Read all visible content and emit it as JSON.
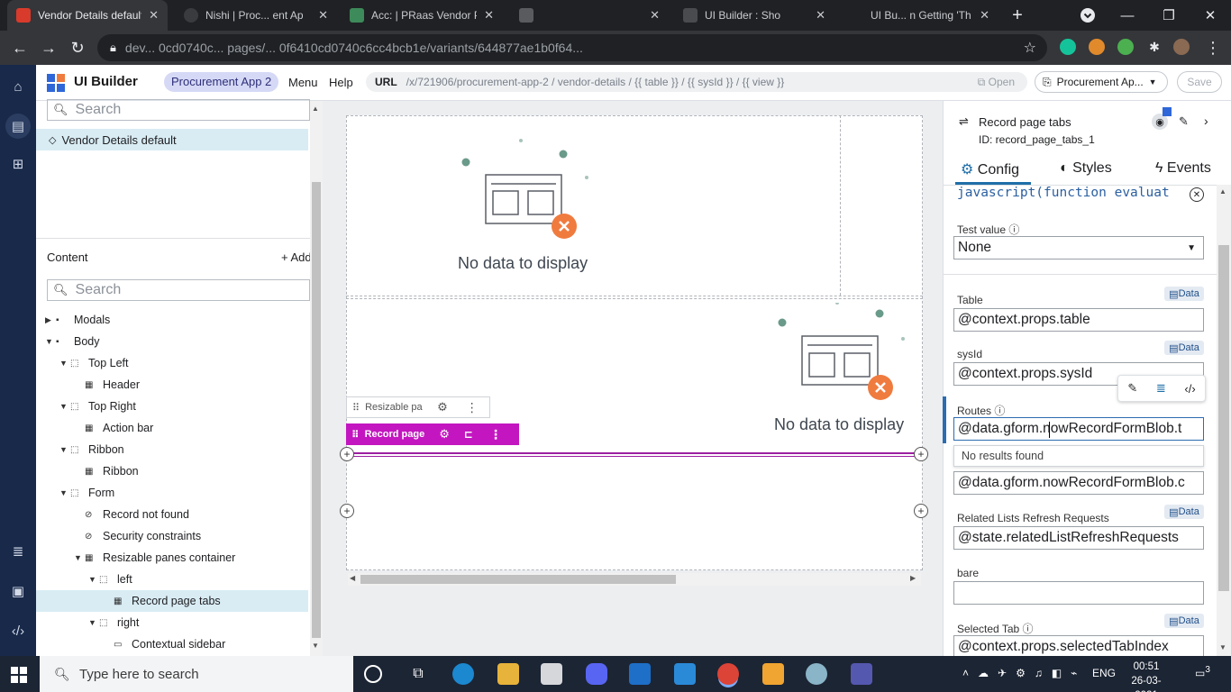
{
  "browser": {
    "tabs": [
      {
        "title": "Vendor Details default",
        "active": true
      },
      {
        "title": "Nishi | Proc... ent Ap",
        "active": false
      },
      {
        "title": "Acc: | PRaas Vendor P",
        "active": false
      },
      {
        "title": "",
        "active": false
      },
      {
        "title": "UI Builder : Sho",
        "active": false
      },
      {
        "title": "UI Bu... n Getting 'Th",
        "active": false
      }
    ],
    "url": "dev... 0cd0740c... pages/... 0f6410cd0740c6cc4bcb1e/variants/644877ae1b0f64...",
    "new_tab": "+",
    "minimize": "—",
    "restore": "❐",
    "close": "✕"
  },
  "app": {
    "brand": "UI Builder",
    "app_name": "Procurement App 2",
    "menu": "Menu",
    "help": "Help",
    "url_label": "URL",
    "url_path": "/x/721906/procurement-app-2 / vendor-details / {{ table }} / {{ sysId }} / {{ view }}",
    "open_label": "Open",
    "variant_select": "Procurement Ap...",
    "save_label": "Save"
  },
  "left": {
    "search_placeholder": "Search",
    "variant": "Vendor Details default",
    "content_header": "Content",
    "add_label": "+ Add",
    "content_search_placeholder": "Search",
    "tree": [
      {
        "label": "Modals",
        "depth": 0,
        "caret": "▶",
        "icon": "▪",
        "selected": false
      },
      {
        "label": "Body",
        "depth": 0,
        "caret": "▼",
        "icon": "▪",
        "selected": false
      },
      {
        "label": "Top Left",
        "depth": 1,
        "caret": "▼",
        "icon": "⬚",
        "selected": false
      },
      {
        "label": "Header",
        "depth": 2,
        "caret": "",
        "icon": "▦",
        "selected": false
      },
      {
        "label": "Top Right",
        "depth": 1,
        "caret": "▼",
        "icon": "⬚",
        "selected": false
      },
      {
        "label": "Action bar",
        "depth": 2,
        "caret": "",
        "icon": "▦",
        "selected": false
      },
      {
        "label": "Ribbon",
        "depth": 1,
        "caret": "▼",
        "icon": "⬚",
        "selected": false
      },
      {
        "label": "Ribbon",
        "depth": 2,
        "caret": "",
        "icon": "▦",
        "selected": false
      },
      {
        "label": "Form",
        "depth": 1,
        "caret": "▼",
        "icon": "⬚",
        "selected": false
      },
      {
        "label": "Record not found",
        "depth": 2,
        "caret": "",
        "icon": "⊘",
        "selected": false
      },
      {
        "label": "Security constraints",
        "depth": 2,
        "caret": "",
        "icon": "⊘",
        "selected": false
      },
      {
        "label": "Resizable panes container",
        "depth": 2,
        "caret": "▼",
        "icon": "▦",
        "selected": false
      },
      {
        "label": "left",
        "depth": 3,
        "caret": "▼",
        "icon": "⬚",
        "selected": false
      },
      {
        "label": "Record page tabs",
        "depth": 4,
        "caret": "",
        "icon": "▦",
        "selected": true
      },
      {
        "label": "right",
        "depth": 3,
        "caret": "▼",
        "icon": "⬚",
        "selected": false
      },
      {
        "label": "Contextual sidebar",
        "depth": 4,
        "caret": "",
        "icon": "▭",
        "selected": false
      }
    ]
  },
  "canvas": {
    "no_data_1": "No data to display",
    "no_data_2": "No data to display",
    "resizable_label": "Resizable pai",
    "record_label": "Record page"
  },
  "right": {
    "component_title": "Record page tabs",
    "component_id": "ID: record_page_tabs_1",
    "tabs": {
      "config": "Config",
      "styles": "Styles",
      "events": "Events"
    },
    "script_line": "javascript(function evaluat",
    "test_value_label": "Test value",
    "test_value": "None",
    "data_badge": "Data",
    "fields": [
      {
        "label": "Table",
        "value": "@context.props.table",
        "badge": true
      },
      {
        "label": "sysId",
        "value": "@context.props.sysId",
        "badge": true
      },
      {
        "label": "Routes",
        "value": "@data.gform.nowRecordFormBlob.t",
        "badge": false
      },
      {
        "label": "",
        "value": "@data.gform.nowRecordFormBlob.c",
        "badge": false
      },
      {
        "label": "Related Lists Refresh Requests",
        "value": "@state.relatedListRefreshRequests",
        "badge": true
      },
      {
        "label": "bare",
        "value": "",
        "badge": false
      },
      {
        "label": "Selected Tab",
        "value": "@context.props.selectedTabIndex",
        "badge": true
      }
    ],
    "no_results": "No results found"
  },
  "taskbar": {
    "search_placeholder": "Type here to search",
    "lang": "ENG",
    "time": "00:51",
    "date": "26-03-2021",
    "notifications": "3"
  },
  "colors": {
    "rail": "#18294a",
    "accent_pink": "#c316c0",
    "selection": "#d9ecf4",
    "orange": "#f07b3f"
  }
}
